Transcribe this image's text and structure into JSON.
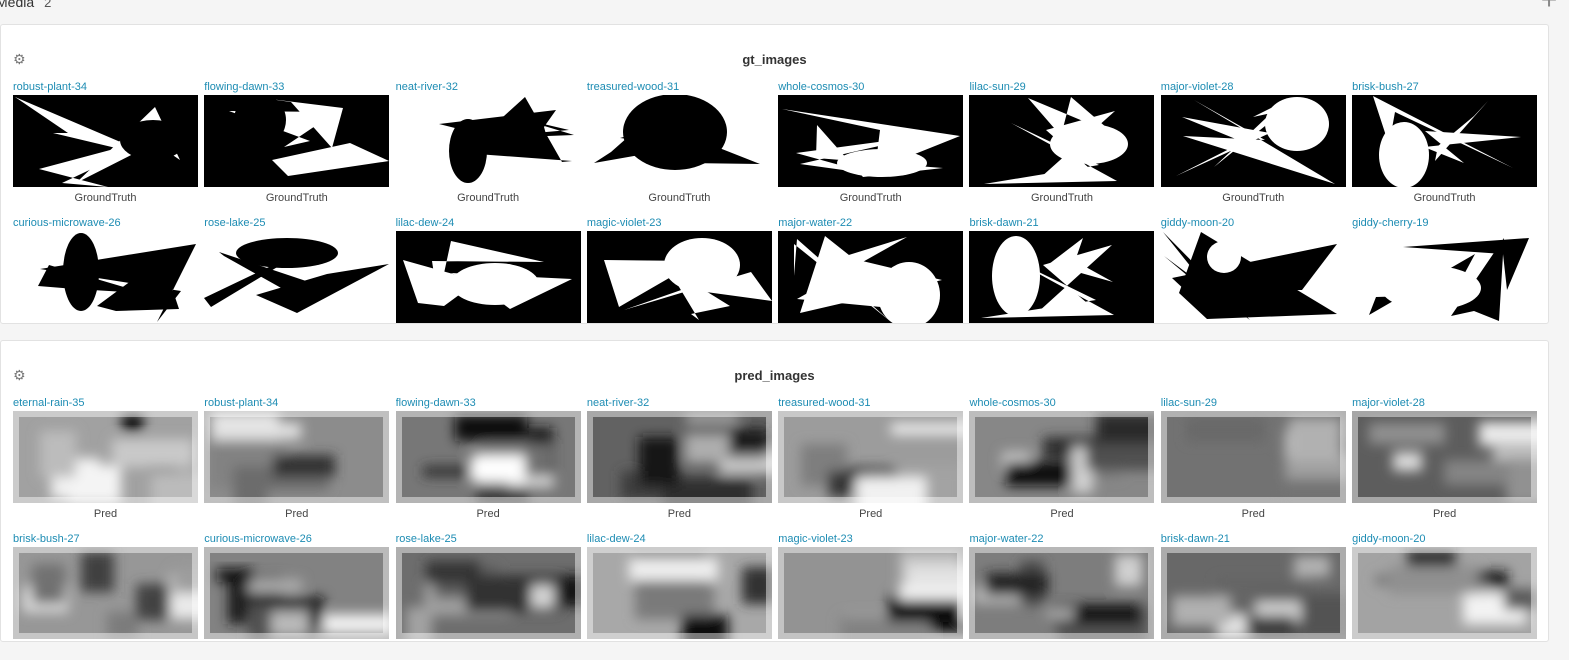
{
  "section": {
    "title": "Media",
    "count": "2"
  },
  "gt_panel": {
    "title": "gt_images",
    "caption": "GroundTruth",
    "items": [
      "robust-plant-34",
      "flowing-dawn-33",
      "neat-river-32",
      "treasured-wood-31",
      "whole-cosmos-30",
      "lilac-sun-29",
      "major-violet-28",
      "brisk-bush-27",
      "curious-microwave-26",
      "rose-lake-25",
      "lilac-dew-24",
      "magic-violet-23",
      "major-water-22",
      "brisk-dawn-21",
      "giddy-moon-20",
      "giddy-cherry-19"
    ]
  },
  "pred_panel": {
    "title": "pred_images",
    "caption": "Pred",
    "items": [
      "eternal-rain-35",
      "robust-plant-34",
      "flowing-dawn-33",
      "neat-river-32",
      "treasured-wood-31",
      "whole-cosmos-30",
      "lilac-sun-29",
      "major-violet-28",
      "brisk-bush-27",
      "curious-microwave-26",
      "rose-lake-25",
      "lilac-dew-24",
      "magic-violet-23",
      "major-water-22",
      "brisk-dawn-21",
      "giddy-moon-20"
    ]
  },
  "colors": {
    "link": "#1d8cb3",
    "panel_bg": "#ffffff",
    "page_bg": "#f5f5f5"
  }
}
